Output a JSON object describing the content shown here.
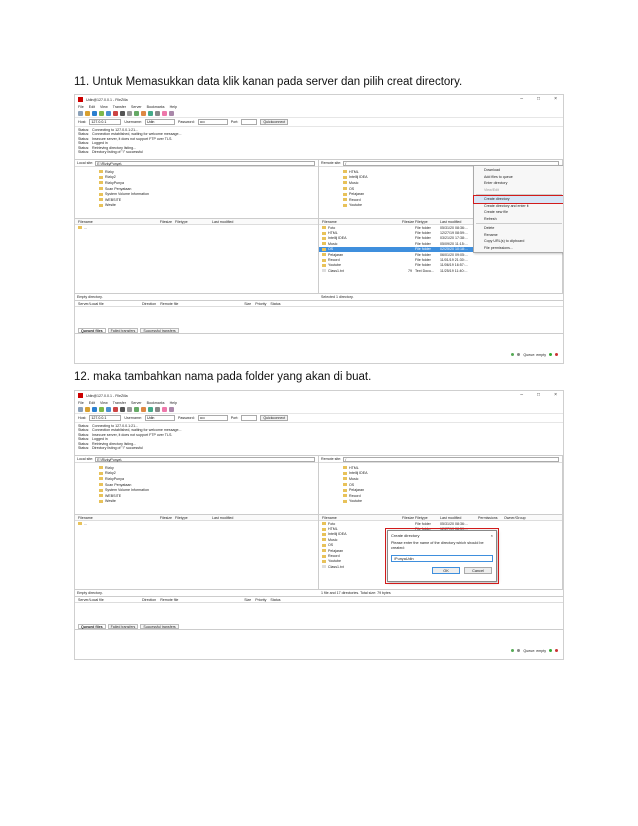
{
  "steps": [
    {
      "caption": "11. Untuk Memasukkan data klik kanan pada server dan pilih creat directory."
    },
    {
      "caption": "12. maka tambahkan nama pada folder yang akan di buat."
    }
  ],
  "app": {
    "title": "Udin@127.0.0.1 - FileZilla",
    "menu": [
      "File",
      "Edit",
      "View",
      "Transfer",
      "Server",
      "Bookmarks",
      "Help"
    ],
    "window_controls": [
      "–",
      "□",
      "×"
    ],
    "quickconnect": {
      "host_label": "Host:",
      "host_value": "127.0.0.1",
      "username_label": "Username:",
      "username_value": "Udin",
      "password_label": "Password:",
      "password_value": "••••",
      "port_label": "Port:",
      "port_value": "",
      "button": "Quickconnect"
    },
    "log": [
      {
        "k": "Status:",
        "v": "Connecting to 127.0.0.1:21..."
      },
      {
        "k": "Status:",
        "v": "Connection established, waiting for welcome message..."
      },
      {
        "k": "Status:",
        "v": "Insecure server, it does not support FTP over TLS."
      },
      {
        "k": "Status:",
        "v": "Logged in"
      },
      {
        "k": "Status:",
        "v": "Retrieving directory listing..."
      },
      {
        "k": "Status:",
        "v": "Directory listing of \"/\" successful"
      }
    ],
    "local": {
      "site_label": "Local site:",
      "path": "E:\\RizkyPunya\\",
      "tree": [
        "Rizky",
        "Rizky2",
        "RizkyPunya",
        "Scan Penyataan",
        "System Volume Information",
        "WEBSITE",
        "Wesite"
      ],
      "headers": [
        "Filename",
        "Filesize",
        "Filetype",
        "Last modified"
      ],
      "files": [
        "..."
      ],
      "status": "Empty directory."
    },
    "remote": {
      "site_label": "Remote site:",
      "path": "/",
      "tree": [
        "HTML",
        "Intellij IDEA",
        "Music",
        "OS",
        "Pelajaran",
        "Record",
        "Youtube"
      ],
      "headers": [
        "Filename",
        "Filesize",
        "Filetype",
        "Last modified",
        "Permissions",
        "Owner/Group"
      ],
      "files": [
        {
          "name": "Foto",
          "size": "",
          "type": "File folder",
          "mod": "05/31/20 08:36:..."
        },
        {
          "name": "HTML",
          "size": "",
          "type": "File folder",
          "mod": "12/27/19 08:59:..."
        },
        {
          "name": "Intellij IDEA",
          "size": "",
          "type": "File folder",
          "mod": "03/21/20 17:38:..."
        },
        {
          "name": "Music",
          "size": "",
          "type": "File folder",
          "mod": "05/09/20 11:15:..."
        },
        {
          "name": "OS",
          "size": "",
          "type": "File folder",
          "mod": "02/25/20 10:18:..."
        },
        {
          "name": "Pelajaran",
          "size": "",
          "type": "File folder",
          "mod": "06/01/20 09:05:..."
        },
        {
          "name": "Record",
          "size": "",
          "type": "File folder",
          "mod": "11/01/19 21:30:..."
        },
        {
          "name": "Youtube",
          "size": "",
          "type": "File folder",
          "mod": "11/06/19 16:57:..."
        },
        {
          "name": "Class1.txt",
          "size": "79",
          "type": "Text Docu...",
          "mod": "11/25/19 11:40:..."
        }
      ],
      "status_1": "Selected 1 directory.",
      "status_2": "1 file and 17 directories. Total size: 79 bytes"
    },
    "queue": {
      "headers": [
        "Server/Local file",
        "Direction",
        "Remote file",
        "Size",
        "Priority",
        "Status"
      ],
      "tabs": [
        "Queued files",
        "Failed transfers",
        "Successful transfers"
      ],
      "footer": "Queue: empty"
    },
    "context_menu": [
      {
        "label": "Download",
        "dim": false,
        "hl": false
      },
      {
        "label": "Add files to queue",
        "dim": false,
        "hl": false
      },
      {
        "label": "Enter directory",
        "dim": false,
        "hl": false
      },
      {
        "label": "View/Edit",
        "dim": true,
        "hl": false
      },
      {
        "sep": true
      },
      {
        "label": "Create directory",
        "dim": false,
        "hl": true
      },
      {
        "label": "Create directory and enter it",
        "dim": false,
        "hl": false
      },
      {
        "label": "Create new file",
        "dim": false,
        "hl": false
      },
      {
        "label": "Refresh",
        "dim": false,
        "hl": false
      },
      {
        "sep": true
      },
      {
        "label": "Delete",
        "dim": false,
        "hl": false
      },
      {
        "label": "Rename",
        "dim": false,
        "hl": false
      },
      {
        "label": "Copy URL(s) to clipboard",
        "dim": false,
        "hl": false
      },
      {
        "label": "File permissions...",
        "dim": false,
        "hl": false
      }
    ],
    "dialog": {
      "title": "Create directory",
      "close": "×",
      "message": "Please enter the name of the directory which should be created:",
      "value": "/PunyaUdin",
      "ok": "OK",
      "cancel": "Cancel"
    }
  },
  "colors": {
    "accent": "#3f8fdd",
    "highlight": "#d21b1b",
    "folder": "#e8c25a"
  }
}
